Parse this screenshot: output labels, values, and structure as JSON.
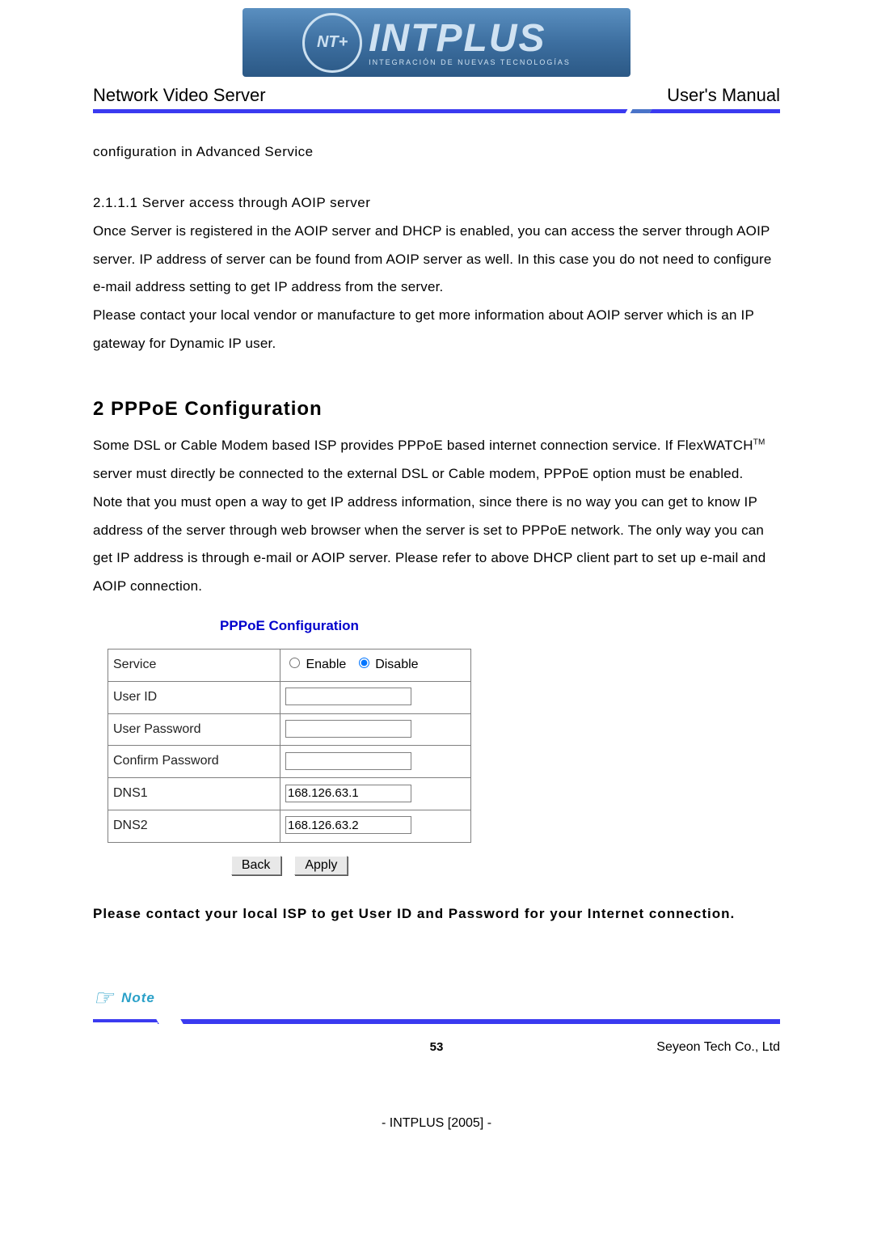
{
  "logo": {
    "medal_text": "NT+",
    "brand": "INTPLUS",
    "tagline": "INTEGRACIÓN DE NUEVAS TECNOLOGÍAS"
  },
  "header": {
    "left": "Network Video Server",
    "right": "User's Manual"
  },
  "body": {
    "config_line": "configuration in Advanced Service",
    "sub_211": "2.1.1.1 Server access through AOIP server",
    "para1": "Once Server is registered in the AOIP server and DHCP is enabled, you can access the server through AOIP server. IP address of server can be found from AOIP server as well. In this case you do not need to configure e-mail address setting to get IP address from the server.",
    "para2": "Please contact your local vendor or manufacture to get more information about AOIP server which is an IP gateway for Dynamic IP user.",
    "h2": "2 PPPoE Configuration",
    "pppoe1a": "Some DSL or Cable Modem based ISP provides PPPoE based internet connection service. If FlexWATCH",
    "pppoe1_tm": "TM",
    "pppoe1b": " server must directly be connected to the external DSL or Cable modem, PPPoE option must be enabled.",
    "pppoe2": "Note that you must open a way to get IP address information, since there is no way you can get to know IP address of the server through web browser when the server is set to PPPoE network. The only way you can get IP address is through e-mail or AOIP server. Please refer to above DHCP client part to set up e-mail and AOIP connection.",
    "contact": "Please contact your local ISP to get User ID and Password for your Internet connection."
  },
  "form": {
    "title": "PPPoE Configuration",
    "labels": {
      "service": "Service",
      "enable": "Enable",
      "disable": "Disable",
      "user_id": "User ID",
      "user_pw": "User Password",
      "confirm_pw": "Confirm Password",
      "dns1": "DNS1",
      "dns2": "DNS2"
    },
    "values": {
      "service": "disable",
      "user_id": "",
      "user_pw": "",
      "confirm_pw": "",
      "dns1": "168.126.63.1",
      "dns2": "168.126.63.2"
    },
    "buttons": {
      "back": "Back",
      "apply": "Apply"
    }
  },
  "note": {
    "icon": "☞",
    "label": "Note"
  },
  "footer": {
    "page": "53",
    "company": "Seyeon Tech Co., Ltd",
    "imprint": "- INTPLUS [2005] -"
  }
}
